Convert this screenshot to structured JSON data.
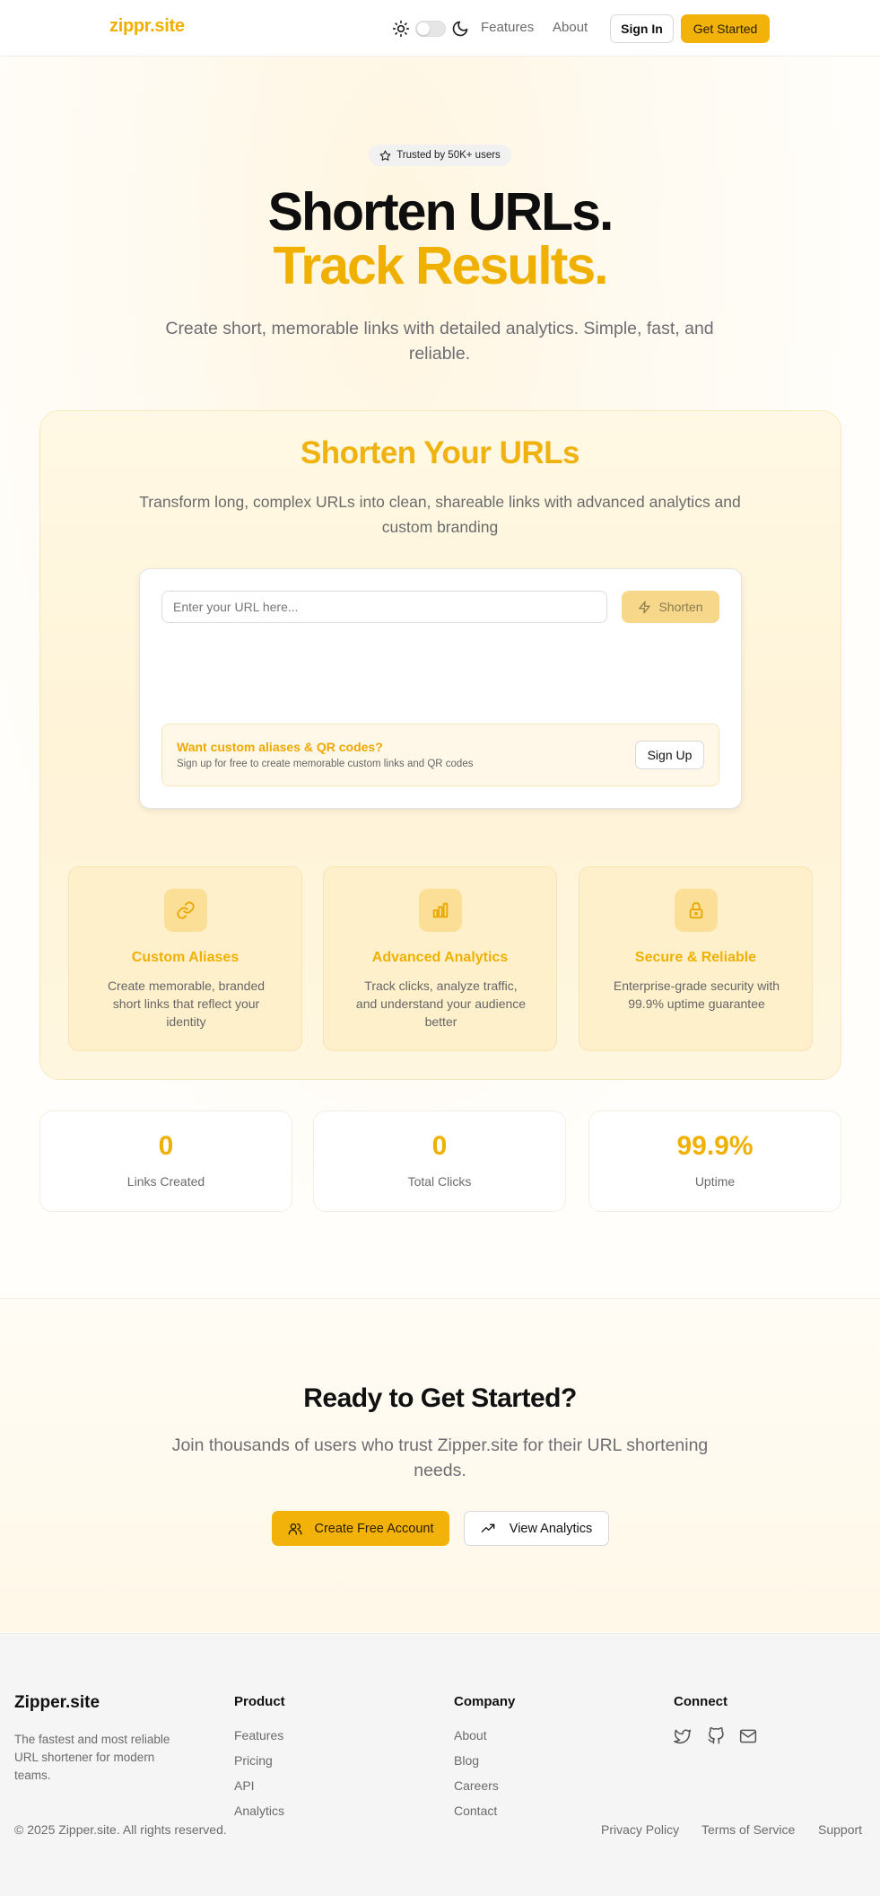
{
  "header": {
    "logo": "zippr.site",
    "nav": {
      "features": "Features",
      "about": "About"
    },
    "sign_in": "Sign In",
    "get_started": "Get Started",
    "theme_toggle": "off"
  },
  "hero": {
    "badge": "Trusted by 50K+ users",
    "title_line1": "Shorten URLs.",
    "title_line2": "Track Results.",
    "subtitle": "Create short, memorable links with detailed analytics. Simple, fast, and reliable."
  },
  "shortener": {
    "title": "Shorten Your URLs",
    "subtitle": "Transform long, complex URLs into clean, shareable links with advanced analytics and custom branding",
    "input_placeholder": "Enter your URL here...",
    "shorten_label": "Shorten",
    "promo_title": "Want custom aliases & QR codes?",
    "promo_text": "Sign up for free to create memorable custom links and QR codes",
    "signup_label": "Sign Up"
  },
  "features": [
    {
      "icon": "link-icon",
      "title": "Custom Aliases",
      "desc": "Create memorable, branded short links that reflect your identity"
    },
    {
      "icon": "bar-chart-icon",
      "title": "Advanced Analytics",
      "desc": "Track clicks, analyze traffic, and understand your audience better"
    },
    {
      "icon": "lock-icon",
      "title": "Secure & Reliable",
      "desc": "Enterprise-grade security with 99.9% uptime guarantee"
    }
  ],
  "stats": [
    {
      "value": "0",
      "label": "Links Created"
    },
    {
      "value": "0",
      "label": "Total Clicks"
    },
    {
      "value": "99.9%",
      "label": "Uptime"
    }
  ],
  "cta": {
    "title": "Ready to Get Started?",
    "subtitle": "Join thousands of users who trust Zipper.site for their URL shortening needs.",
    "create_label": "Create Free Account",
    "analytics_label": "View Analytics"
  },
  "footer": {
    "brand": "Zipper.site",
    "tagline": "The fastest and most reliable URL shortener for modern teams.",
    "product_heading": "Product",
    "product_links": [
      "Features",
      "Pricing",
      "API",
      "Analytics"
    ],
    "company_heading": "Company",
    "company_links": [
      "About",
      "Blog",
      "Careers",
      "Contact"
    ],
    "connect_heading": "Connect",
    "social": [
      "twitter-icon",
      "github-icon",
      "mail-icon"
    ],
    "copyright": "© 2025 Zipper.site. All rights reserved.",
    "legal": {
      "privacy": "Privacy Policy",
      "terms": "Terms of Service",
      "support": "Support"
    }
  },
  "colors": {
    "accent": "#f2b20a",
    "accent_text": "#f0b000",
    "muted": "#6b6b6b"
  }
}
